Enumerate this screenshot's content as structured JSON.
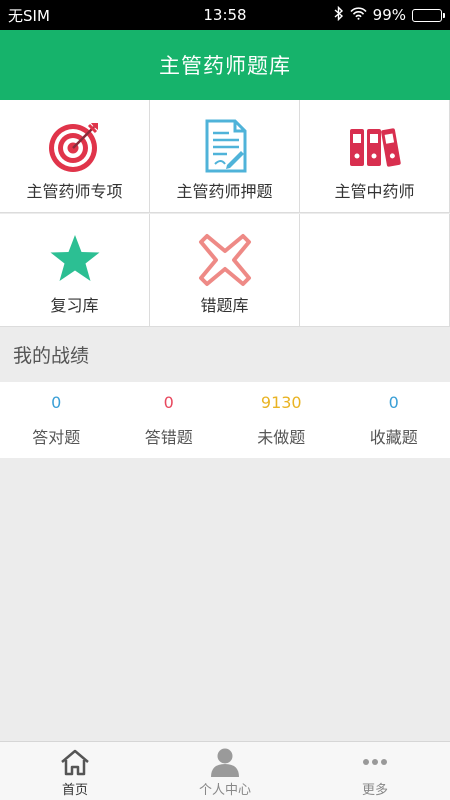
{
  "status_bar": {
    "carrier": "无SIM",
    "time": "13:58",
    "battery": "99%"
  },
  "header": {
    "title": "主管药师题库"
  },
  "menu": {
    "items": [
      {
        "label": "主管药师专项",
        "icon": "target-icon"
      },
      {
        "label": "主管药师押题",
        "icon": "document-icon"
      },
      {
        "label": "主管中药师",
        "icon": "binders-icon"
      },
      {
        "label": "复习库",
        "icon": "star-icon"
      },
      {
        "label": "错题库",
        "icon": "cross-icon"
      }
    ]
  },
  "stats_section": {
    "title": "我的战绩",
    "items": [
      {
        "value": "0",
        "label": "答对题",
        "color": "#3a9fd6"
      },
      {
        "value": "0",
        "label": "答错题",
        "color": "#e8485e"
      },
      {
        "value": "9130",
        "label": "未做题",
        "color": "#e9b323"
      },
      {
        "value": "0",
        "label": "收藏题",
        "color": "#3a9fd6"
      }
    ]
  },
  "tabbar": {
    "tabs": [
      {
        "label": "首页",
        "icon": "home-icon",
        "active": true
      },
      {
        "label": "个人中心",
        "icon": "person-icon",
        "active": false
      },
      {
        "label": "更多",
        "icon": "more-icon",
        "active": false
      }
    ]
  },
  "colors": {
    "accent": "#16b36b",
    "target_red": "#e0344a",
    "doc_blue": "#4fb3d9",
    "binder_red": "#d82f4f",
    "star_green": "#2cbf93",
    "cross_red": "#ee8a86"
  }
}
